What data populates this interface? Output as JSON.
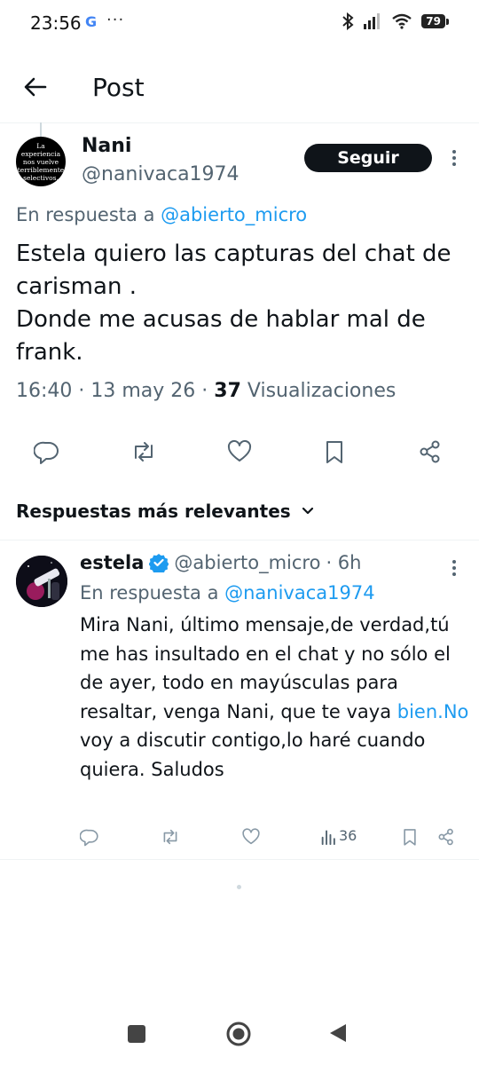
{
  "status_bar": {
    "time": "23:56",
    "google_glyph": "G",
    "more_dots": "···",
    "battery": "79",
    "icons": [
      "bluetooth-icon",
      "signal-icon",
      "wifi-icon",
      "battery-icon"
    ]
  },
  "header": {
    "title": "Post",
    "back_icon": "arrow-left-icon"
  },
  "post": {
    "avatar_text": "La experiencia nos vuelve terriblemente selectivos.",
    "display_name": "Nani",
    "handle": "@nanivaca1974",
    "follow_label": "Seguir",
    "reply_prefix": "En respuesta a ",
    "reply_to": "@abierto_micro",
    "text": "Estela quiero las capturas del chat de carisman .\nDonde me acusas de hablar mal de frank.",
    "time": "16:40",
    "sep": " · ",
    "date": "13 may 26",
    "views_count": "37",
    "views_label": " Visualizaciones"
  },
  "sort": {
    "label": "Respuestas más relevantes"
  },
  "reply": {
    "display_name": "estela",
    "handle": "@abierto_micro",
    "sep": " · ",
    "age": "6h",
    "reply_prefix": "En respuesta a ",
    "reply_to": "@nanivaca1974",
    "text_before": "Mira Nani, último mensaje,de verdad,tú me has insultado en el chat y no sólo el de ayer, todo en mayúsculas para resaltar, venga Nani, que te vaya ",
    "text_link": "bien.No",
    "text_after": " voy a discutir contigo,lo haré cuando quiera. Saludos",
    "views": "36"
  },
  "colors": {
    "accent": "#1d9bf0",
    "text": "#0f1419",
    "muted": "#536471",
    "divider": "#eff3f4",
    "verified": "#1d9bf0"
  }
}
